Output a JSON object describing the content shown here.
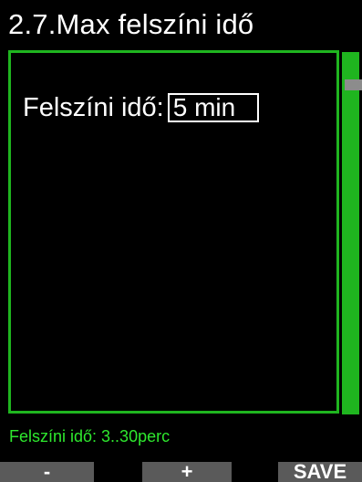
{
  "header": {
    "title": "2.7.Max felszíni idő"
  },
  "setting": {
    "label": "Felszíni idő:",
    "value": "5 min"
  },
  "hint": {
    "text": "Felszíni idő: 3..30perc"
  },
  "buttons": {
    "minus": "-",
    "plus": "+",
    "save": "SAVE"
  },
  "colors": {
    "accent": "#1fb51f",
    "hint": "#2ee82e",
    "button": "#5a5a5a",
    "scroll_thumb": "#8c8c8c"
  }
}
